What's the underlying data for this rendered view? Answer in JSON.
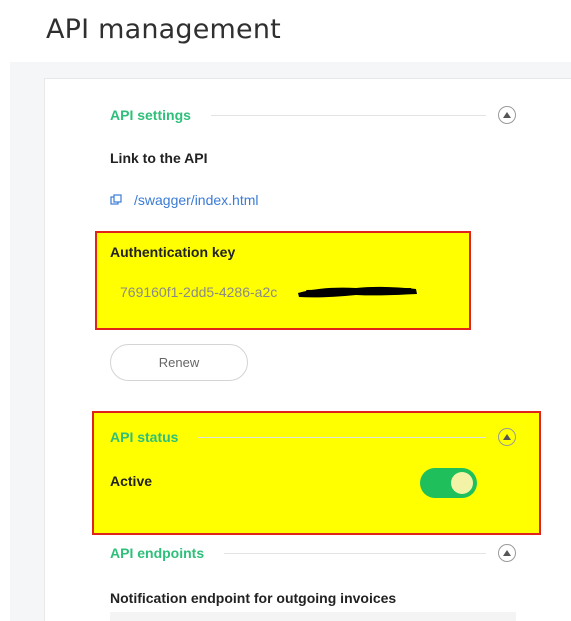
{
  "page": {
    "title": "API management"
  },
  "settings": {
    "section_title": "API settings",
    "link_label": "Link to the API",
    "link_text": "/swagger/index.html",
    "auth_key_label": "Authentication key",
    "auth_key_value": "769160f1-2dd5-4286-a2c",
    "renew_label": "Renew"
  },
  "status": {
    "section_title": "API status",
    "active_label": "Active",
    "toggle_on": true
  },
  "endpoints": {
    "section_title": "API endpoints",
    "notification_label": "Notification endpoint for outgoing invoices"
  },
  "colors": {
    "accent_green": "#2ec07a",
    "toggle_green": "#1fbf5c",
    "link_blue": "#3a7bd5",
    "highlight_yellow": "#ffff00",
    "highlight_border": "#e0241c"
  },
  "icons": {
    "collapse": "chevron-up-icon",
    "copy": "copy-icon"
  }
}
